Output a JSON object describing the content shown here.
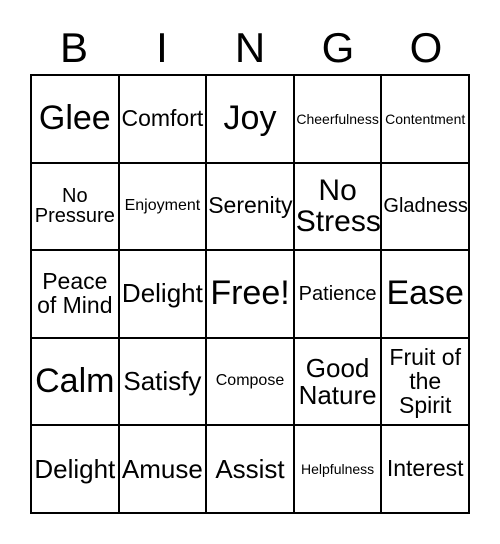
{
  "card": {
    "header_letters": [
      "B",
      "I",
      "N",
      "G",
      "O"
    ],
    "grid_size": "5x5",
    "text_color": "#000000",
    "border_color": "#000000",
    "background_color": "#ffffff",
    "rows": [
      [
        {
          "text": "Glee",
          "size": "xxl"
        },
        {
          "text": "Comfort",
          "size": "m"
        },
        {
          "text": "Joy",
          "size": "xxl"
        },
        {
          "text": "Cheerfulness",
          "size": "xxs"
        },
        {
          "text": "Contentment",
          "size": "xxs"
        }
      ],
      [
        {
          "text": "No Pressure",
          "size": "s"
        },
        {
          "text": "Enjoyment",
          "size": "xs"
        },
        {
          "text": "Serenity",
          "size": "m"
        },
        {
          "text": "No Stress",
          "size": "xl"
        },
        {
          "text": "Gladness",
          "size": "s"
        }
      ],
      [
        {
          "text": "Peace of Mind",
          "size": "m"
        },
        {
          "text": "Delight",
          "size": "l"
        },
        {
          "text": "Free!",
          "size": "xxl"
        },
        {
          "text": "Patience",
          "size": "s"
        },
        {
          "text": "Ease",
          "size": "xxl"
        }
      ],
      [
        {
          "text": "Calm",
          "size": "xxl"
        },
        {
          "text": "Satisfy",
          "size": "l"
        },
        {
          "text": "Compose",
          "size": "xs"
        },
        {
          "text": "Good Nature",
          "size": "l"
        },
        {
          "text": "Fruit of the Spirit",
          "size": "m"
        }
      ],
      [
        {
          "text": "Delight",
          "size": "l"
        },
        {
          "text": "Amuse",
          "size": "l"
        },
        {
          "text": "Assist",
          "size": "l"
        },
        {
          "text": "Helpfulness",
          "size": "xxs"
        },
        {
          "text": "Interest",
          "size": "m"
        }
      ]
    ]
  }
}
